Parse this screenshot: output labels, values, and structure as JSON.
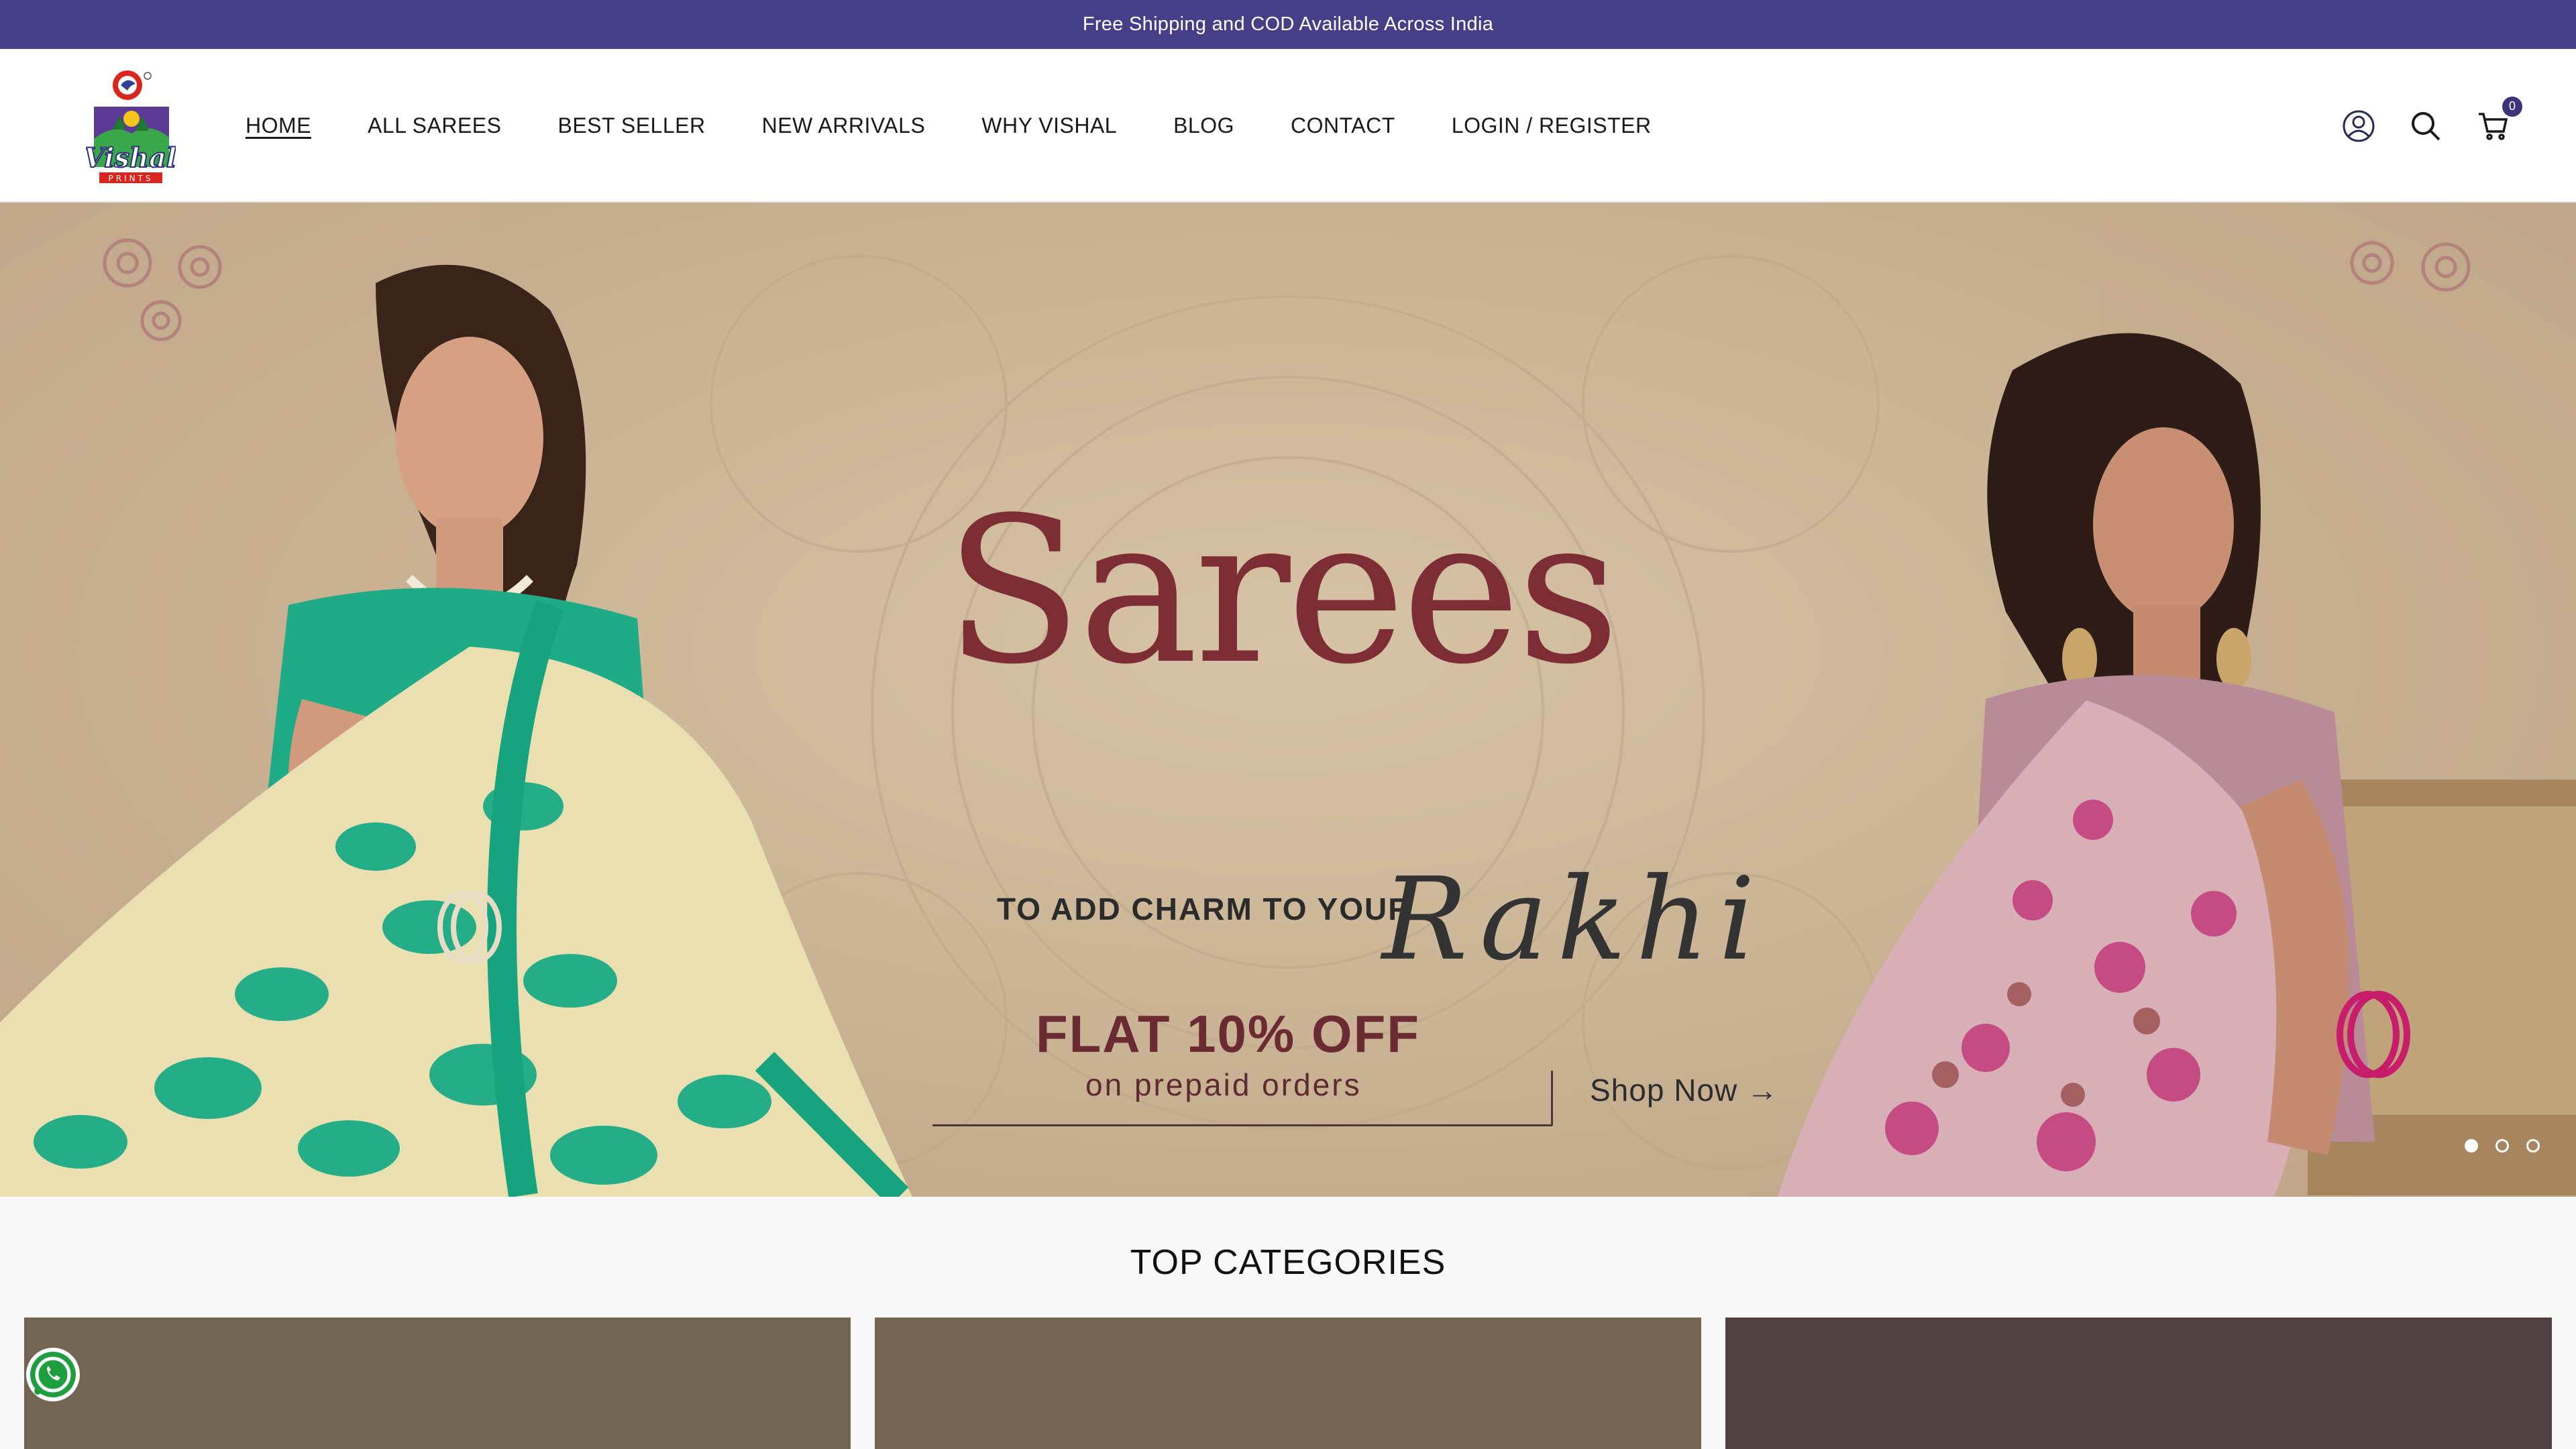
{
  "announcement": "Free Shipping and COD Available Across India",
  "brand": {
    "name": "Vishal",
    "sub": "PRINTS"
  },
  "nav": {
    "items": [
      {
        "label": "HOME",
        "active": true
      },
      {
        "label": "ALL SAREES"
      },
      {
        "label": "BEST SELLER"
      },
      {
        "label": "NEW ARRIVALS"
      },
      {
        "label": "WHY VISHAL"
      },
      {
        "label": "BLOG"
      },
      {
        "label": "CONTACT"
      },
      {
        "label": "LOGIN / REGISTER"
      }
    ]
  },
  "header_icons": {
    "account": "user-icon",
    "search": "search-icon",
    "cart": "cart-icon",
    "cart_count": "0"
  },
  "hero": {
    "title": "Sarees",
    "tagline": "TO ADD CHARM TO YOUR",
    "script_word": "Rakhi",
    "offer_title": "FLAT 10% OFF",
    "offer_sub": "on prepaid orders",
    "cta": "Shop Now →",
    "slides": 3,
    "active_slide": 1
  },
  "categories": {
    "title": "TOP CATEGORIES"
  },
  "colors": {
    "announcement_bg": "#443f87",
    "accent": "#7c2e34",
    "hero_bg": "#c9b293"
  }
}
